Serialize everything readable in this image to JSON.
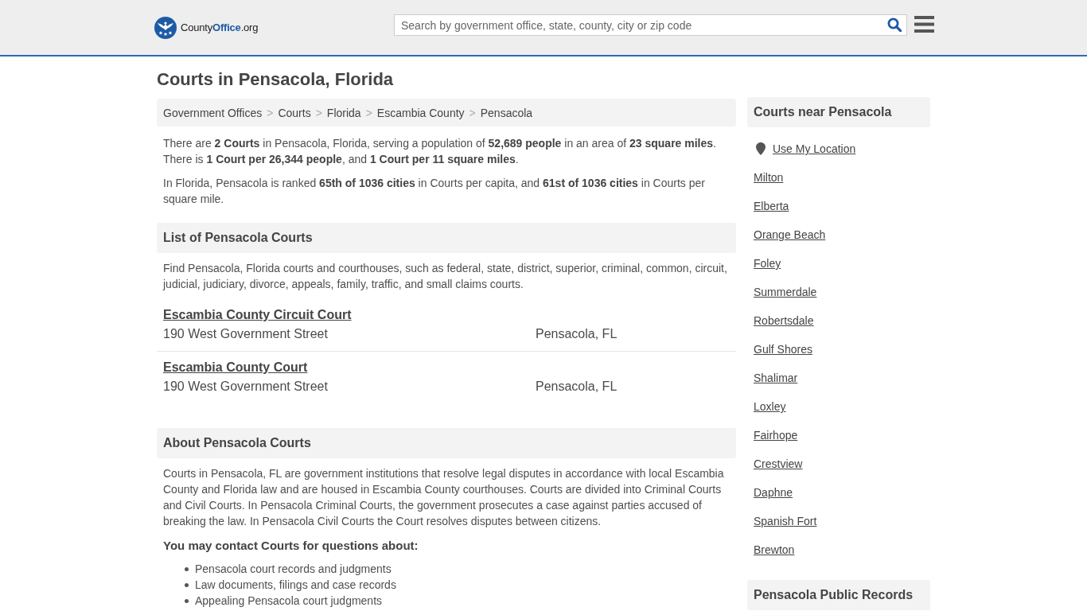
{
  "header": {
    "logo": "County**Office**.org",
    "search": {
      "placeholder": "Search by government office, state, county, city or zip code"
    }
  },
  "page_title": "Courts in Pensacola, Florida",
  "breadcrumb": {
    "separator": ">",
    "items": [
      "Government Offices",
      "Courts",
      "Florida",
      "Escambia County",
      "Pensacola"
    ]
  },
  "summary": [
    "There are **2 Courts** in Pensacola, Florida, serving a population of **52,689 people** in an area of **23 square miles**. There is **1 Court per 26,344 people**, and **1 Court per 11 square miles**.",
    "In Florida, Pensacola is ranked **65th of 1036 cities** in Courts per capita, and **61st of 1036 cities** in Courts per square mile."
  ],
  "list_section": {
    "heading": "List of Pensacola Courts",
    "intro": "Find Pensacola, Florida courts and courthouses, such as federal, state, district, superior, criminal, common, circuit, judicial, judiciary, divorce, appeals, family, traffic, and small claims courts.",
    "courts": [
      {
        "name": "Escambia County Circuit Court",
        "address": "190 West Government Street",
        "city": "Pensacola, FL"
      },
      {
        "name": "Escambia County Court",
        "address": "190 West Government Street",
        "city": "Pensacola, FL"
      }
    ]
  },
  "about_section": {
    "heading": "About Pensacola Courts",
    "text": "Courts in Pensacola, FL are government institutions that resolve legal disputes in accordance with local Escambia County and Florida law and are housed in Escambia County courthouses. Courts are divided into Criminal Courts and Civil Courts. In Pensacola Criminal Courts, the government prosecutes a case against parties accused of breaking the law. In Pensacola Civil Courts the Court resolves disputes between citizens.",
    "subheading": "You may contact Courts for questions about:",
    "topics": [
      "Pensacola court records and judgments",
      "Law documents, filings and case records",
      "Appealing Pensacola court judgments"
    ]
  },
  "sidebar": {
    "heading": "Courts near Pensacola",
    "location_link": "Use My Location",
    "cities": [
      "Milton",
      "Elberta",
      "Orange Beach",
      "Foley",
      "Summerdale",
      "Robertsdale",
      "Gulf Shores",
      "Shalimar",
      "Loxley",
      "Fairhope",
      "Crestview",
      "Daphne",
      "Spanish Fort",
      "Brewton"
    ],
    "next_heading": "Pensacola Public Records"
  }
}
